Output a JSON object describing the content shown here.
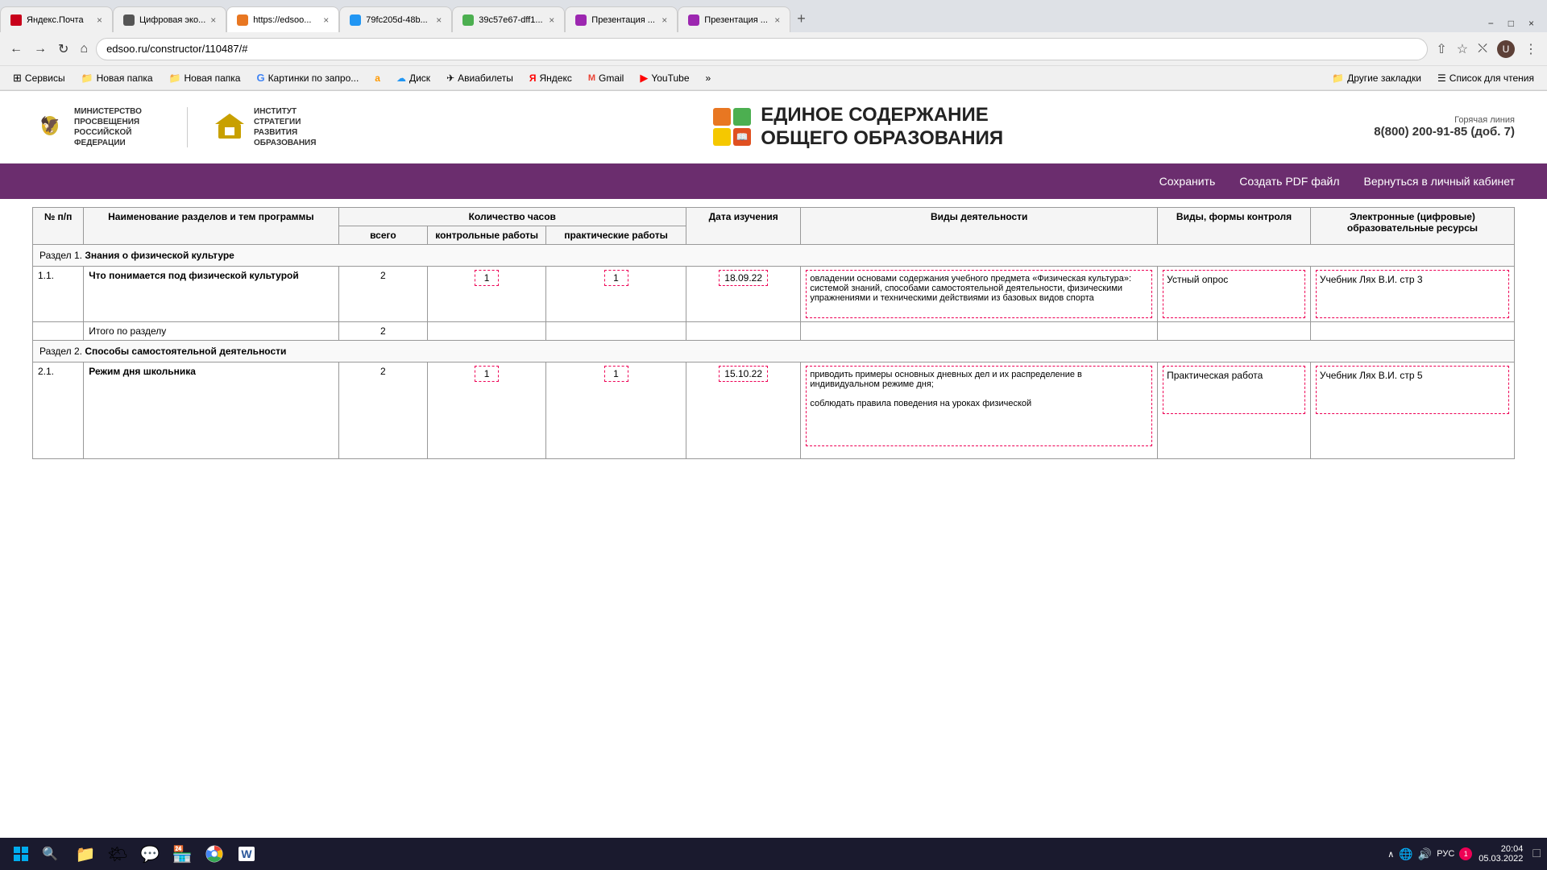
{
  "browser": {
    "tabs": [
      {
        "id": 1,
        "favicon_color": "#c8001a",
        "title": "Яндекс.Почта",
        "active": false
      },
      {
        "id": 2,
        "favicon_color": "#444",
        "title": "Цифровая эко...",
        "active": false
      },
      {
        "id": 3,
        "favicon_color": "#e87722",
        "title": "https://edsoo...",
        "active": true
      },
      {
        "id": 4,
        "favicon_color": "#2196f3",
        "title": "79fc205d-48b...",
        "active": false
      },
      {
        "id": 5,
        "favicon_color": "#4caf50",
        "title": "39c57e67-dff1...",
        "active": false
      },
      {
        "id": 6,
        "favicon_color": "#9c27b0",
        "title": "Презентация ...",
        "active": false
      },
      {
        "id": 7,
        "favicon_color": "#9c27b0",
        "title": "Презентация ...",
        "active": false
      }
    ],
    "address": "edsoo.ru/constructor/110487/#",
    "win_buttons": [
      "−",
      "□",
      "×"
    ]
  },
  "bookmarks": [
    {
      "label": "Сервисы",
      "icon": "grid"
    },
    {
      "label": "Новая папка",
      "icon": "folder"
    },
    {
      "label": "Новая папка",
      "icon": "folder"
    },
    {
      "label": "Картинки по запро...",
      "icon": "google"
    },
    {
      "label": "а",
      "icon": "ok"
    },
    {
      "label": "Диск",
      "icon": "disk"
    },
    {
      "label": "Авиабилеты",
      "icon": "plane"
    },
    {
      "label": "Яндекс",
      "icon": "yandex"
    },
    {
      "label": "Gmail",
      "icon": "gmail"
    },
    {
      "label": "YouTube",
      "icon": "youtube"
    },
    {
      "label": "»",
      "icon": "more"
    },
    {
      "label": "Другие закладки",
      "icon": "folder"
    },
    {
      "label": "Список для чтения",
      "icon": "list"
    }
  ],
  "site": {
    "logo_left_1": "МИНИСТЕРСТВО ПРОСВЕЩЕНИЯ РОССИЙСКОЙ ФЕДЕРАЦИИ",
    "logo_left_2": "ИНСТИТУТ СТРАТЕГИИ РАЗВИТИЯ ОБРАЗОВАНИЯ",
    "site_title_line1": "ЕДИНОЕ СОДЕРЖАНИЕ",
    "site_title_line2": "ОБЩЕГО ОБРАЗОВАНИЯ",
    "hotline_label": "Горячая линия",
    "hotline_number": "8(800) 200-91-85 (доб. 7)",
    "nav_save": "Сохранить",
    "nav_pdf": "Создать PDF файл",
    "nav_cabinet": "Вернуться в личный кабинет"
  },
  "table": {
    "headers": {
      "num": "№ п/п",
      "name": "Наименование разделов и тем программы",
      "hours_total": "всего",
      "hours_control": "контрольные работы",
      "hours_practice": "практические работы",
      "date": "Дата изучения",
      "activities": "Виды деятельности",
      "control_types": "Виды, формы контроля",
      "resources": "Электронные (цифровые) образовательные ресурсы",
      "hours_group": "Количество часов"
    },
    "section1": {
      "label": "Раздел 1. Знания о физической культуре",
      "rows": [
        {
          "num": "1.1.",
          "name": "Что понимается под физической культурой",
          "hours": "2",
          "control": "1",
          "practice": "1",
          "date": "18.09.22",
          "activities": "овладении основами содержания учебного предмета «Физическая культура»: системой знаний, способами самостоятельной деятельности, физическими упражнениями и техническими действиями из базовых видов спорта",
          "control_type": "Устный опрос",
          "resource": "Учебник Лях В.И. стр 3"
        }
      ],
      "total_label": "Итого по разделу",
      "total_hours": "2"
    },
    "section2": {
      "label": "Раздел 2. Способы самостоятельной деятельности",
      "rows": [
        {
          "num": "2.1.",
          "name": "Режим дня школьника",
          "hours": "2",
          "control": "1",
          "practice": "1",
          "date": "15.10.22",
          "activities": "приводить примеры основных дневных дел и их распределение в индивидуальном режиме дня;\n\nсоблюдать правила поведения на уроках физической",
          "control_type": "Практическая работа",
          "resource": "Учебник Лях В.И. стр 5"
        }
      ]
    }
  },
  "taskbar": {
    "time": "20:04",
    "date": "05.03.2022",
    "lang": "РУС",
    "notification_count": "1"
  }
}
